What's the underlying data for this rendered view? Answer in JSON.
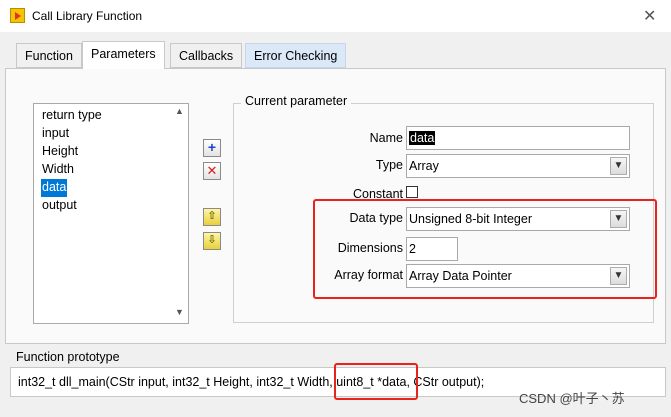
{
  "window": {
    "title": "Call Library Function"
  },
  "tabs": [
    {
      "label": "Function"
    },
    {
      "label": "Parameters"
    },
    {
      "label": "Callbacks"
    },
    {
      "label": "Error Checking"
    }
  ],
  "param_list": {
    "items": [
      "return type",
      "input",
      "Height",
      "Width",
      "data",
      "output"
    ],
    "selected": "data"
  },
  "group": {
    "title": "Current parameter"
  },
  "fields": {
    "name_label": "Name",
    "name_value": "data",
    "type_label": "Type",
    "type_value": "Array",
    "constant_label": "Constant",
    "data_type_label": "Data type",
    "data_type_value": "Unsigned 8-bit Integer",
    "dimensions_label": "Dimensions",
    "dimensions_value": "2",
    "array_format_label": "Array format",
    "array_format_value": "Array Data Pointer"
  },
  "prototype": {
    "label": "Function prototype",
    "text_before": "int32_t dll_main(CStr input, int32_t Height, int32_t Width, ",
    "text_highlight": "uint8_t *data",
    "text_after": ", CStr output);"
  },
  "watermark": "CSDN @叶子丶苏",
  "colors": {
    "selection": "#0078d7",
    "annotation_red": "#e8231e",
    "tab_highlight": "#dbe8f7"
  },
  "icons": [
    "add-icon",
    "delete-icon",
    "move-up-icon",
    "move-down-icon",
    "checkbox-icon",
    "dropdown-arrow-icon"
  ]
}
